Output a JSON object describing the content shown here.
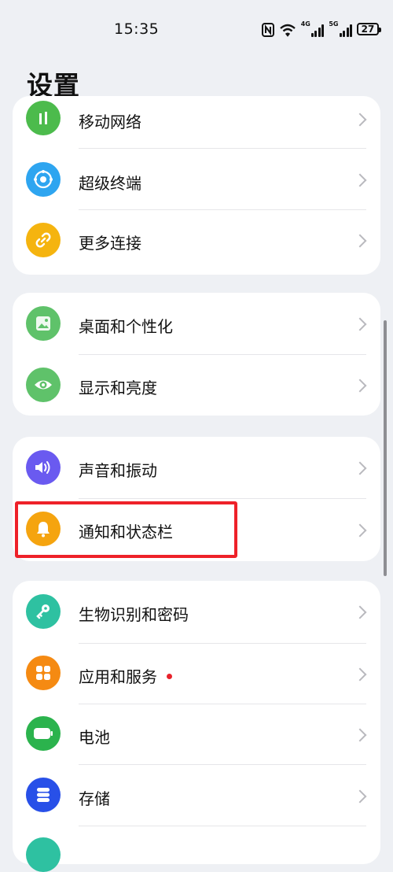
{
  "status_bar": {
    "time": "15:35",
    "net1": "4G",
    "net2": "5G",
    "battery": "27"
  },
  "page": {
    "title": "设置"
  },
  "groups": [
    {
      "items": [
        {
          "label": "移动网络",
          "icon": "mobile-network-icon",
          "color": "#4cbb4c"
        },
        {
          "label": "超级终端",
          "icon": "super-device-icon",
          "color": "#2ea5f0"
        },
        {
          "label": "更多连接",
          "icon": "link-icon",
          "color": "#f5b40f"
        }
      ]
    },
    {
      "items": [
        {
          "label": "桌面和个性化",
          "icon": "image-icon",
          "color": "#5fc26a"
        },
        {
          "label": "显示和亮度",
          "icon": "eye-icon",
          "color": "#5fc26a"
        }
      ]
    },
    {
      "items": [
        {
          "label": "声音和振动",
          "icon": "speaker-icon",
          "color": "#6a5af0"
        },
        {
          "label": "通知和状态栏",
          "icon": "bell-icon",
          "color": "#f5a40f"
        }
      ]
    },
    {
      "items": [
        {
          "label": "生物识别和密码",
          "icon": "key-icon",
          "color": "#2ec1a1"
        },
        {
          "label": "应用和服务",
          "icon": "apps-grid-icon",
          "color": "#f58a12"
        },
        {
          "label": "电池",
          "icon": "battery-icon",
          "color": "#2bb34d"
        },
        {
          "label": "存储",
          "icon": "storage-icon",
          "color": "#2850e8"
        }
      ]
    }
  ],
  "highlight_color": "#ee2129"
}
